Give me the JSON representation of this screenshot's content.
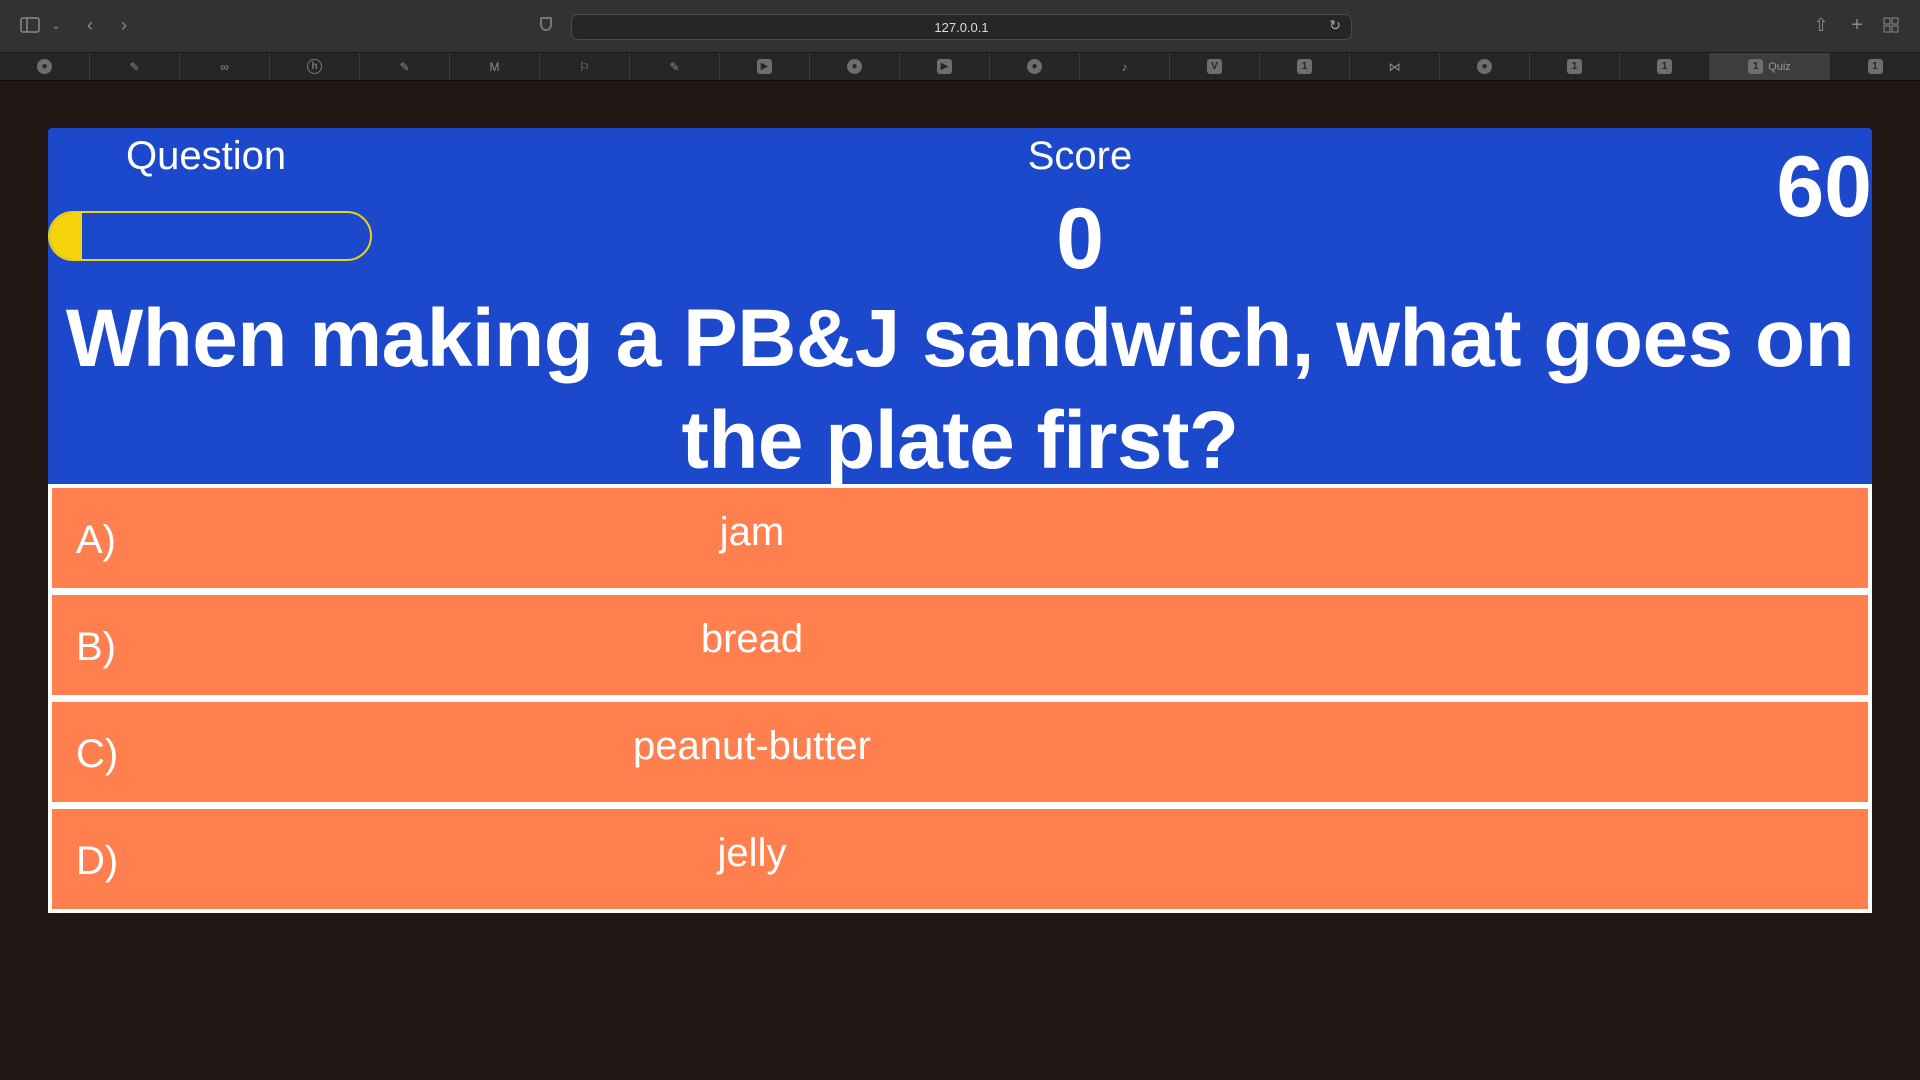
{
  "browser": {
    "url": "127.0.0.1",
    "active_tab_title": "Quiz",
    "tab_badge": "1"
  },
  "quiz": {
    "question_label": "Question",
    "progress_fraction": 0.1,
    "score_label": "Score",
    "score_value": "0",
    "timer_value": "60",
    "question_text": "When making a PB&J sandwich, what goes on the plate first?",
    "answers": [
      {
        "letter": "A)",
        "text": "jam"
      },
      {
        "letter": "B)",
        "text": "bread"
      },
      {
        "letter": "C)",
        "text": "peanut-butter"
      },
      {
        "letter": "D)",
        "text": "jelly"
      }
    ],
    "colors": {
      "header": "#1c48cc",
      "answer": "#ff7f4f",
      "progress": "#f6d40c",
      "page_bg": "#211715"
    }
  }
}
